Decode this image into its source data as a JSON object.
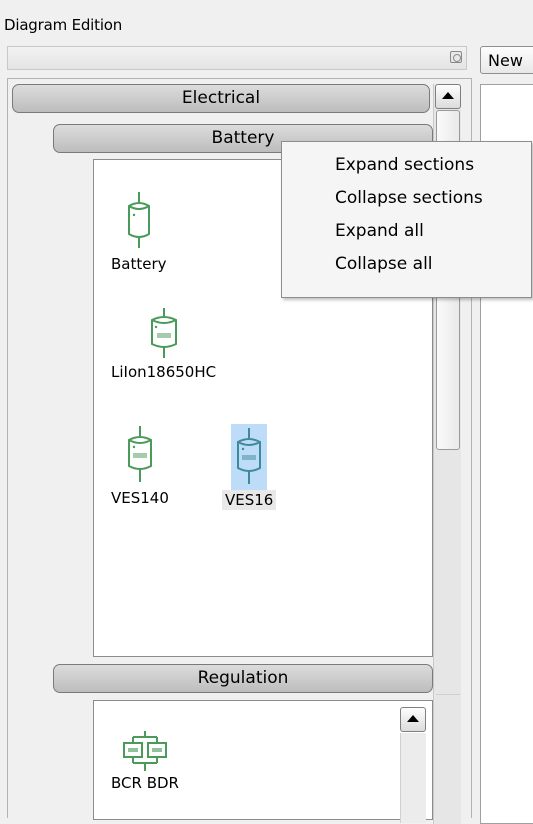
{
  "window": {
    "title": "Diagram Edition"
  },
  "right_panel": {
    "tab_label": "New"
  },
  "sections": {
    "electrical": "Electrical",
    "battery": "Battery",
    "regulation": "Regulation"
  },
  "battery_components": [
    {
      "label": "Battery",
      "icon": "battery-icon"
    },
    {
      "label": "LiIon18650HC",
      "icon": "battery-icon"
    },
    {
      "label": "VES140",
      "icon": "battery-icon"
    },
    {
      "label": "VES16",
      "icon": "battery-icon",
      "selected": true
    }
  ],
  "regulation_components": [
    {
      "label": "BCR BDR",
      "icon": "regulator-icon"
    }
  ],
  "context_menu": {
    "items": [
      "Expand sections",
      "Collapse sections",
      "Expand all",
      "Collapse all"
    ]
  },
  "colors": {
    "icon_green": "#4a9a5a",
    "selection_blue": "#bcdcf7"
  }
}
